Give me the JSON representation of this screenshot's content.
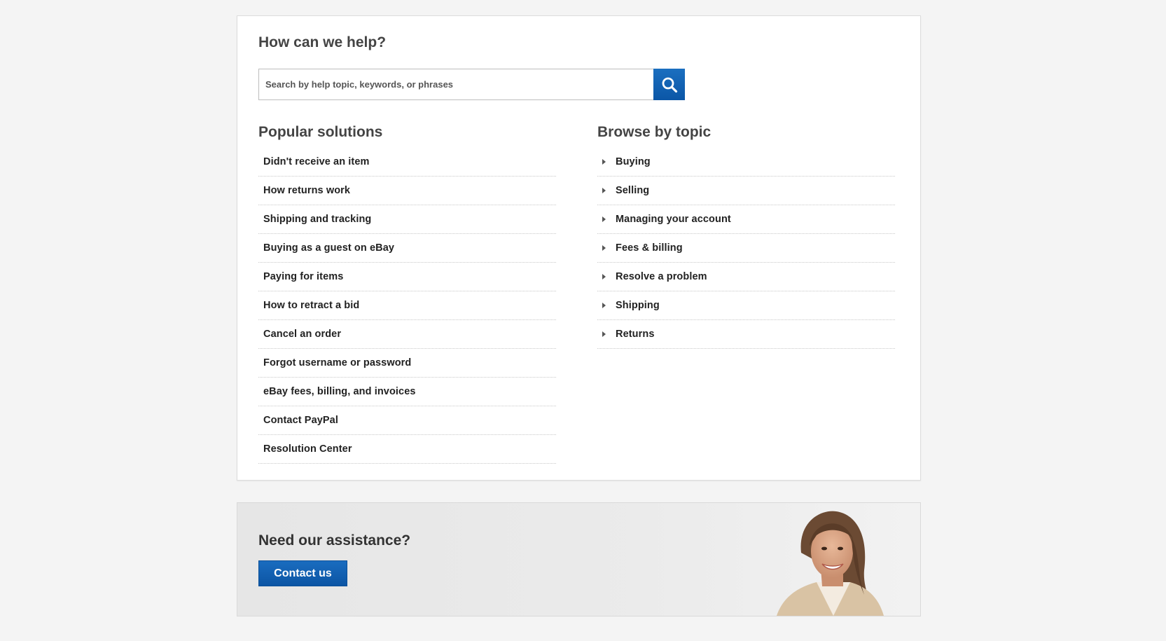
{
  "help": {
    "title": "How can we help?",
    "search_placeholder": "Search by help topic, keywords, or phrases",
    "search_icon": "search-icon"
  },
  "popular": {
    "title": "Popular solutions",
    "items": [
      "Didn't receive an item",
      "How returns work",
      "Shipping and tracking",
      "Buying as a guest on eBay",
      "Paying for items",
      "How to retract a bid",
      "Cancel an order",
      "Forgot username or password",
      "eBay fees, billing, and invoices",
      "Contact PayPal",
      "Resolution Center"
    ]
  },
  "topics": {
    "title": "Browse by topic",
    "items": [
      "Buying",
      "Selling",
      "Managing your account",
      "Fees & billing",
      "Resolve a problem",
      "Shipping",
      "Returns"
    ],
    "item_icon": "caret-right-icon"
  },
  "assist": {
    "title": "Need our assistance?",
    "button": "Contact us",
    "photo": "support-agent-photo"
  },
  "colors": {
    "accent": "#0c5aa8",
    "page_bg": "#f4f4f4",
    "text": "#222222"
  }
}
